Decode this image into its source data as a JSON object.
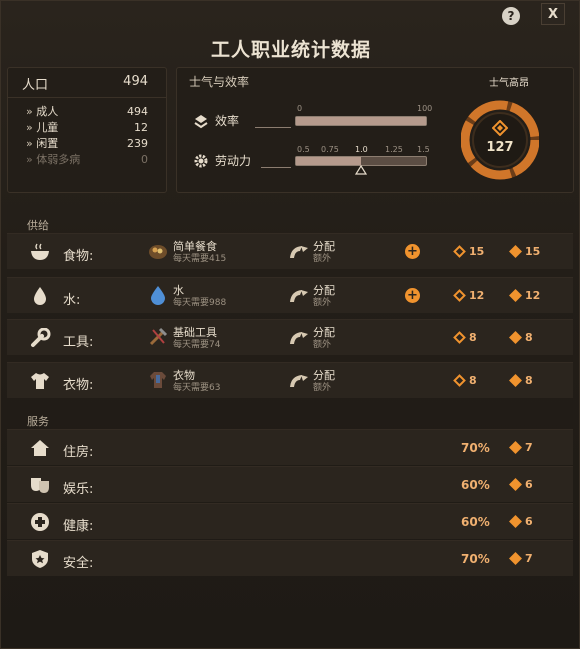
{
  "title": "工人职业统计数据",
  "help_label": "?",
  "close_label": "X",
  "population": {
    "label": "人口",
    "total": "494",
    "rows": [
      {
        "label": "成人",
        "value": "494"
      },
      {
        "label": "儿童",
        "value": "12"
      },
      {
        "label": "闲置",
        "value": "239"
      },
      {
        "label": "体弱多病",
        "value": "0"
      }
    ]
  },
  "morale": {
    "header": "士气与效率",
    "state": "士气高昂",
    "gauge_value": "127",
    "efficiency": {
      "label": "效率",
      "tick_min": "0",
      "tick_max": "100",
      "value_fraction": 1.0
    },
    "labor": {
      "label": "劳动力",
      "ticks": [
        "0.5",
        "0.75",
        "1.0",
        "1.25",
        "1.5"
      ],
      "value": 1.0
    }
  },
  "supply": {
    "section_label": "供给",
    "rows": [
      {
        "label": "食物:",
        "icon": "bowl-icon",
        "item": "简单餐食",
        "req": "每天需要415",
        "dist": "分配",
        "dist_sub": "额外",
        "has_plus": true,
        "v1": "15",
        "v2": "15"
      },
      {
        "label": "水:",
        "icon": "water-drop-icon",
        "item": "水",
        "req": "每天需要988",
        "dist": "分配",
        "dist_sub": "额外",
        "has_plus": true,
        "v1": "12",
        "v2": "12"
      },
      {
        "label": "工具:",
        "icon": "wrench-icon",
        "item": "基础工具",
        "req": "每天需要74",
        "dist": "分配",
        "dist_sub": "额外",
        "has_plus": false,
        "v1": "8",
        "v2": "8"
      },
      {
        "label": "衣物:",
        "icon": "shirt-icon",
        "item": "衣物",
        "req": "每天需要63",
        "dist": "分配",
        "dist_sub": "额外",
        "has_plus": false,
        "v1": "8",
        "v2": "8"
      }
    ]
  },
  "services": {
    "section_label": "服务",
    "rows": [
      {
        "label": "住房:",
        "icon": "house-icon",
        "pct": "70%",
        "value": "7"
      },
      {
        "label": "娱乐:",
        "icon": "masks-icon",
        "pct": "60%",
        "value": "6"
      },
      {
        "label": "健康:",
        "icon": "health-icon",
        "pct": "60%",
        "value": "6"
      },
      {
        "label": "安全:",
        "icon": "badge-icon",
        "pct": "70%",
        "value": "7"
      }
    ]
  },
  "colors": {
    "accent": "#f0932e",
    "value_text": "#f0b070"
  }
}
